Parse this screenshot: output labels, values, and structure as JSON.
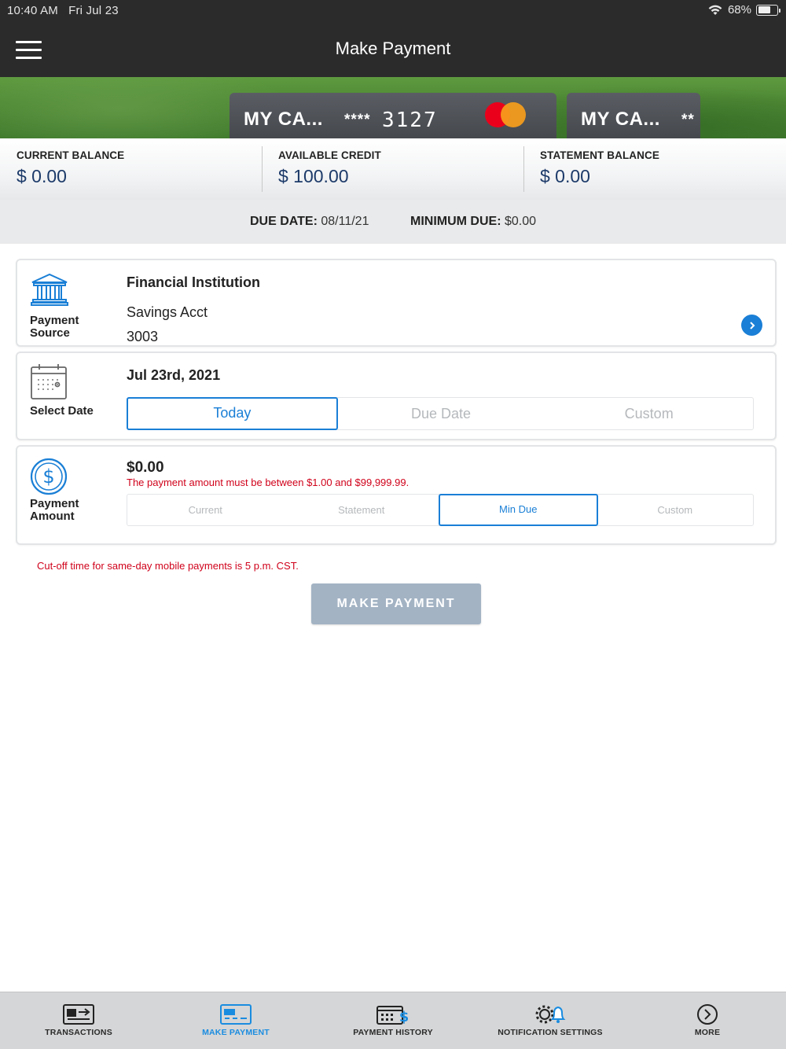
{
  "status_bar": {
    "time": "10:40 AM",
    "date": "Fri Jul 23",
    "battery": "68%",
    "battery_level": 0.68
  },
  "nav": {
    "title": "Make Payment",
    "menu_icon": "hamburger-menu-icon"
  },
  "cards": [
    {
      "name": "MY CA...",
      "mask": "****",
      "last4": "3127",
      "brand": "mastercard"
    },
    {
      "name": "MY CA...",
      "mask": "**"
    }
  ],
  "balances": {
    "current": {
      "label": "CURRENT BALANCE",
      "value": "$ 0.00"
    },
    "available": {
      "label": "AVAILABLE CREDIT",
      "value": "$ 100.00"
    },
    "statement": {
      "label": "STATEMENT BALANCE",
      "value": "$ 0.00"
    }
  },
  "due": {
    "due_date_label": "DUE DATE:",
    "due_date_value": "08/11/21",
    "min_due_label": "MINIMUM DUE:",
    "min_due_value": "$0.00"
  },
  "payment_source": {
    "label_line1": "Payment",
    "label_line2": "Source",
    "institution": "Financial Institution",
    "account_type": "Savings Acct",
    "account_number": "3003",
    "icon": "bank-icon"
  },
  "select_date": {
    "label": "Select Date",
    "date": "Jul 23rd, 2021",
    "options": [
      "Today",
      "Due Date",
      "Custom"
    ],
    "selected": "Today",
    "icon": "calendar-icon"
  },
  "payment_amount": {
    "label_line1": "Payment",
    "label_line2": "Amount",
    "amount": "$0.00",
    "error": "The payment amount must be between $1.00 and $99,999.99.",
    "options": [
      "Current",
      "Statement",
      "Min Due",
      "Custom"
    ],
    "selected": "Min Due",
    "icon": "dollar-circle-icon"
  },
  "cutoff_note": "Cut-off time for same-day mobile payments is 5 p.m. CST.",
  "make_payment_label": "MAKE PAYMENT",
  "tabs": [
    {
      "label": "TRANSACTIONS",
      "icon": "transactions-icon",
      "active": false
    },
    {
      "label": "MAKE PAYMENT",
      "icon": "make-payment-icon",
      "active": true
    },
    {
      "label": "PAYMENT HISTORY",
      "icon": "payment-history-icon",
      "active": false
    },
    {
      "label": "NOTIFICATION SETTINGS",
      "icon": "notification-settings-icon",
      "active": false
    },
    {
      "label": "MORE",
      "icon": "more-icon",
      "active": false
    }
  ],
  "colors": {
    "accent": "#1a7fd6",
    "error": "#d0021b",
    "navy": "#1c3a69",
    "button_disabled": "#a3b3c4",
    "tab_active": "#1a8ce0"
  }
}
